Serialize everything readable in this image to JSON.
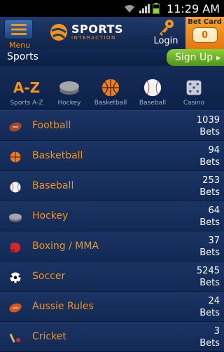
{
  "status_bar": {
    "time": "11:29 AM"
  },
  "header": {
    "menu_label": "Menu",
    "logo_main": "SPORTS",
    "logo_sub": "INTERACTION",
    "login_label": "Login",
    "bet_card_label": "Bet Card",
    "bet_card_count": "0"
  },
  "sub_header": {
    "title": "Sports",
    "signup_label": "Sign Up"
  },
  "categories": [
    {
      "label": "Sports A-Z",
      "icon": "a-z-icon",
      "glyph": "A-Z"
    },
    {
      "label": "Hockey",
      "icon": "hockey-puck-icon"
    },
    {
      "label": "Basketball",
      "icon": "basketball-icon"
    },
    {
      "label": "Baseball",
      "icon": "baseball-icon"
    },
    {
      "label": "Casino",
      "icon": "dice-icon"
    }
  ],
  "sports": [
    {
      "name": "Football",
      "count": "1039",
      "unit": "Bets",
      "icon": "football-icon"
    },
    {
      "name": "Basketball",
      "count": "94",
      "unit": "Bets",
      "icon": "basketball-icon"
    },
    {
      "name": "Baseball",
      "count": "253",
      "unit": "Bets",
      "icon": "baseball-icon"
    },
    {
      "name": "Hockey",
      "count": "64",
      "unit": "Bets",
      "icon": "hockey-puck-icon"
    },
    {
      "name": "Boxing / MMA",
      "count": "37",
      "unit": "Bets",
      "icon": "boxing-glove-icon"
    },
    {
      "name": "Soccer",
      "count": "5245",
      "unit": "Bets",
      "icon": "soccer-ball-icon"
    },
    {
      "name": "Aussie Rules",
      "count": "24",
      "unit": "Bets",
      "icon": "football-icon"
    },
    {
      "name": "Cricket",
      "count": "3",
      "unit": "Bets",
      "icon": "cricket-icon"
    }
  ],
  "colors": {
    "accent": "#f29418",
    "background": "#0c1e3f",
    "signup": "#6cb22a"
  }
}
